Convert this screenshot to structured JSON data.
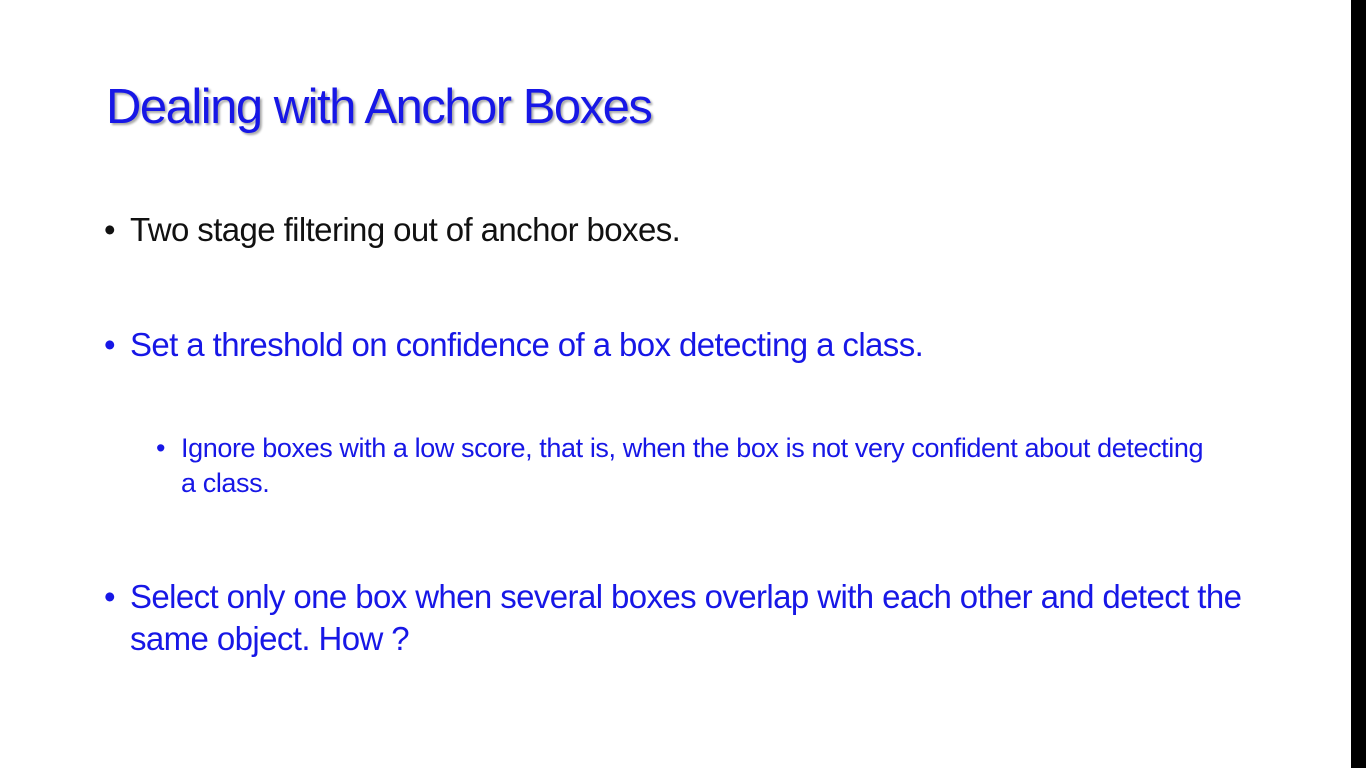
{
  "slide": {
    "title": "Dealing with Anchor Boxes",
    "bullets": [
      {
        "level": 1,
        "marker": "•",
        "text": "Two stage filtering out of anchor boxes.",
        "color": "#111111"
      },
      {
        "level": 1,
        "marker": "•",
        "text": "Set a threshold on confidence of a box detecting a class.",
        "color": "#1717e6"
      },
      {
        "level": 2,
        "marker": "•",
        "text": "Ignore boxes with a low score, that is,  when the box is not very confident about detecting a class.",
        "color": "#1717e6"
      },
      {
        "level": 1,
        "marker": "•",
        "text": "Select only one box when several boxes overlap with each other and detect the same object. How ?",
        "color": "#1717e6"
      }
    ]
  },
  "colors": {
    "title": "#1717e6",
    "accent_text": "#1717e6",
    "body_text": "#111111",
    "background": "#ffffff",
    "right_edge": "#000000"
  }
}
